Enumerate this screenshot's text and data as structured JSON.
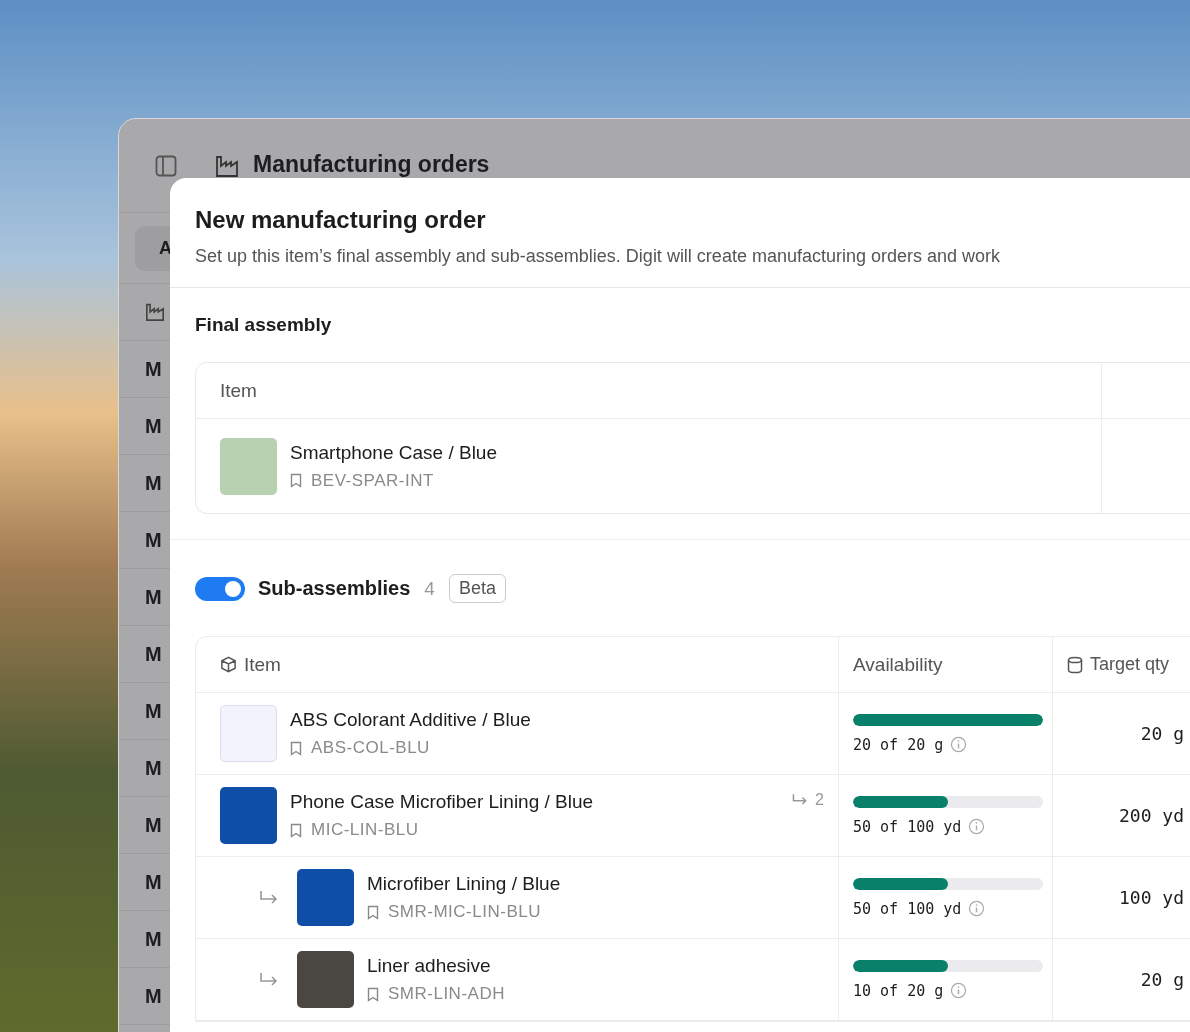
{
  "app_window": {
    "title": "Manufacturing orders",
    "filter_chip": "A",
    "list_rows": [
      "M",
      "M",
      "M",
      "M",
      "M",
      "M",
      "M",
      "M",
      "M",
      "M",
      "M",
      "M"
    ]
  },
  "dialog": {
    "title": "New manufacturing order",
    "description": "Set up this item’s final assembly and sub-assemblies. Digit will create manufacturing orders and work",
    "final_assembly": {
      "heading": "Final assembly",
      "columns": [
        "Item"
      ],
      "item": {
        "name": "Smartphone Case / Blue",
        "sku": "BEV-SPAR-INT"
      }
    },
    "sub_assemblies": {
      "enabled": true,
      "label": "Sub-assemblies",
      "count": "4",
      "badge": "Beta",
      "columns": [
        "Item",
        "Availability",
        "Target qty"
      ],
      "rows": [
        {
          "name": "ABS Colorant Additive / Blue",
          "sku": "ABS-COL-BLU",
          "level": 1,
          "reading": "20 of 20 g",
          "target_qty": "20 g"
        },
        {
          "name": "Phone Case Microfiber Lining / Blue",
          "sku": "MIC-LIN-BLU",
          "child_count": "2",
          "level": 0.5,
          "reading": "50 of 100 yd",
          "target_qty": "200 yd",
          "children": [
            {
              "name": "Microfiber Lining / Blue",
              "sku": "SMR-MIC-LIN-BLU",
              "level": 0.5,
              "reading": "50 of 100 yd",
              "target_qty": "100 yd"
            },
            {
              "name": "Liner adhesive",
              "sku": "SMR-LIN-ADH",
              "level": 0.5,
              "reading": "10 of 20 g",
              "target_qty": "20 g"
            }
          ]
        }
      ]
    }
  }
}
